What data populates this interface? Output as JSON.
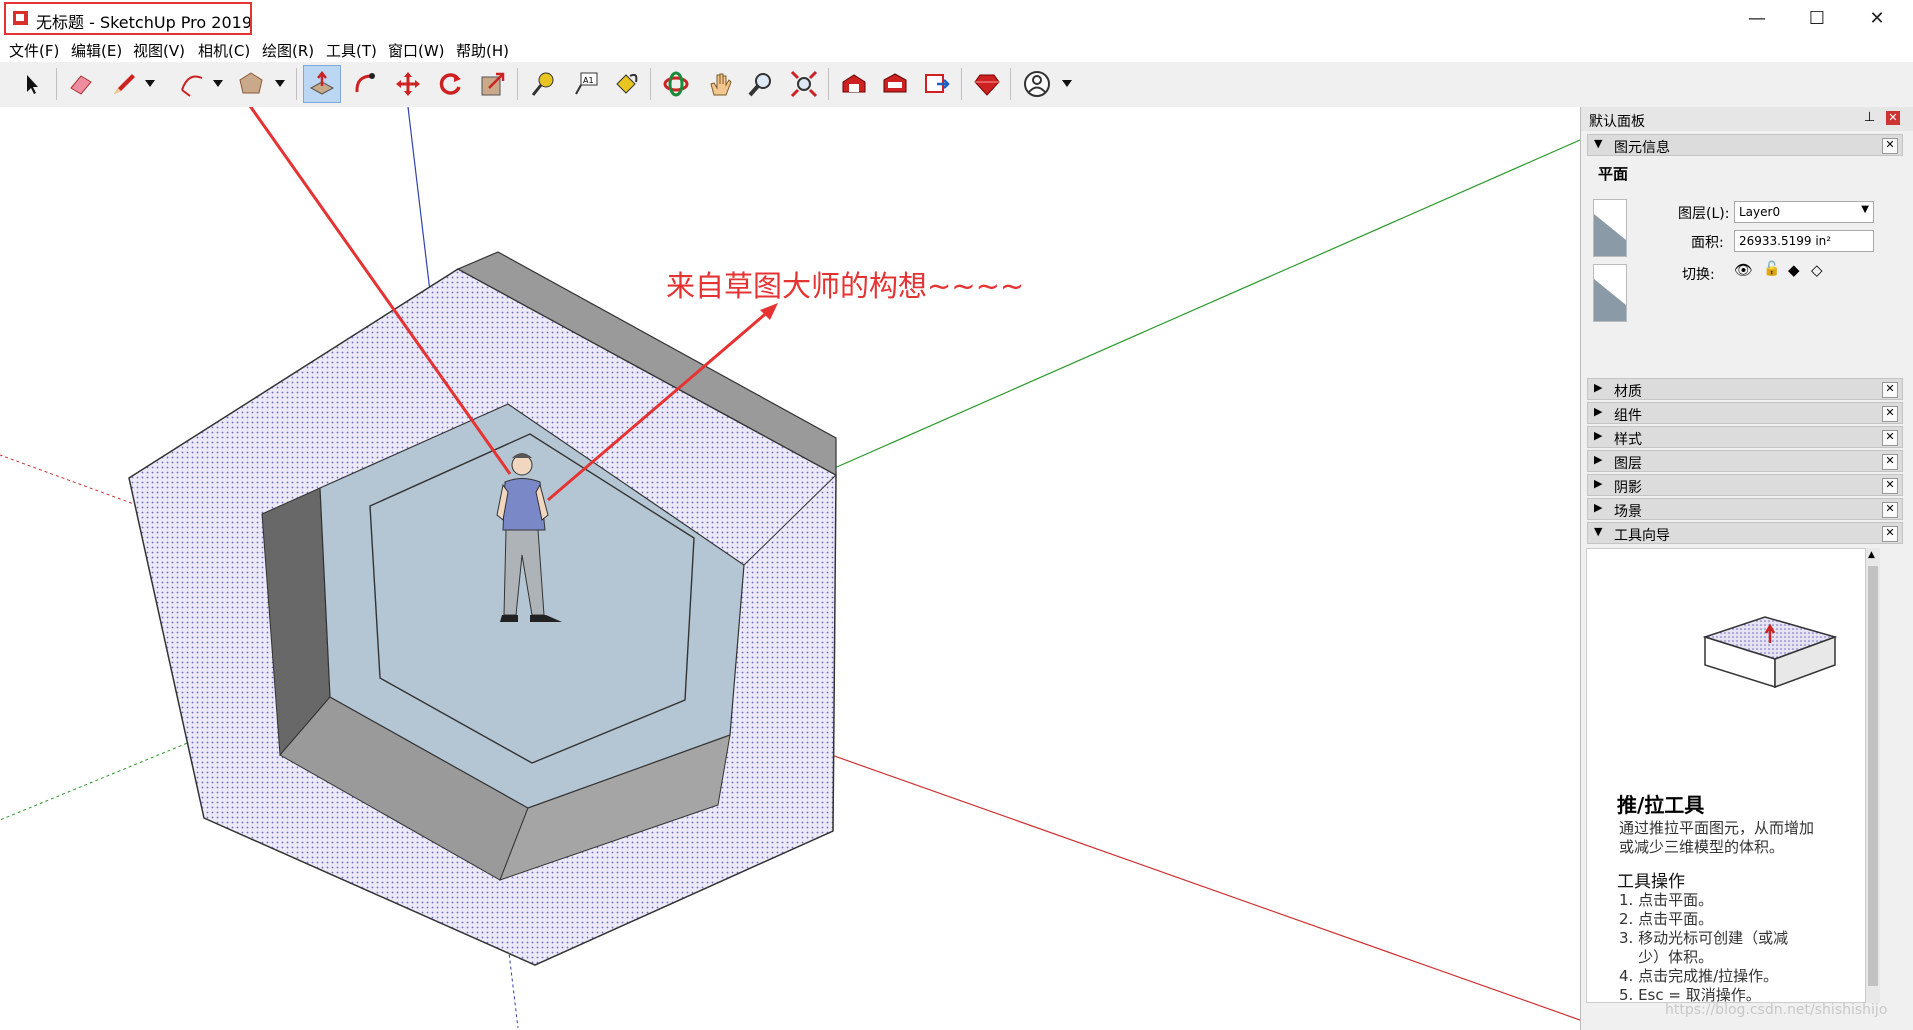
{
  "window": {
    "title": "无标题 - SketchUp Pro 2019",
    "controls": {
      "minimize": "—",
      "maximize": "☐",
      "close": "✕"
    }
  },
  "menu": [
    "文件(F)",
    "编辑(E)",
    "视图(V)",
    "相机(C)",
    "绘图(R)",
    "工具(T)",
    "窗口(W)",
    "帮助(H)"
  ],
  "toolbar": {
    "tools": [
      "select-icon",
      "eraser-icon",
      "pencil-icon",
      "arc-icon",
      "shape-icon",
      "push-pull-icon",
      "follow-me-icon",
      "move-icon",
      "rotate-icon",
      "scale-icon",
      "tape-icon",
      "text-icon",
      "paint-bucket-icon",
      "orbit-icon",
      "pan-icon",
      "zoom-icon",
      "zoom-extents-icon",
      "warehouse-icon",
      "extension-warehouse-icon",
      "layout-icon",
      "ruby-icon",
      "account-icon"
    ],
    "active_tool": "push-pull-icon"
  },
  "annotation": {
    "text": "来自草图大师的构想~~~~"
  },
  "panel": {
    "title": "默认面板",
    "entity_info": {
      "header": "图元信息",
      "entity_type": "平面",
      "layer_label": "图层(L):",
      "layer_value": "Layer0",
      "area_label": "面积:",
      "area_value": "26933.5199 in²",
      "toggle_label": "切换:"
    },
    "trays": [
      "材质",
      "组件",
      "样式",
      "图层",
      "阴影",
      "场景"
    ],
    "instructor": {
      "header": "工具向导",
      "tool_name": "推/拉工具",
      "description": [
        "通过推拉平面图元，从而增加",
        "或减少三维模型的体积。"
      ],
      "ops_title": "工具操作",
      "steps": [
        "1. 点击平面。",
        "2. 点击平面。",
        "3. 移动光标可创建（或减",
        "    少）体积。",
        "4. 点击完成推/拉操作。",
        "5. Esc = 取消操作。"
      ]
    }
  },
  "watermark": "https://blog.csdn.net/shishishijo",
  "colors": {
    "highlight": "#e53333",
    "active_tool_bg": "#bcd7f3",
    "face_blue": "#b4c6d4"
  }
}
